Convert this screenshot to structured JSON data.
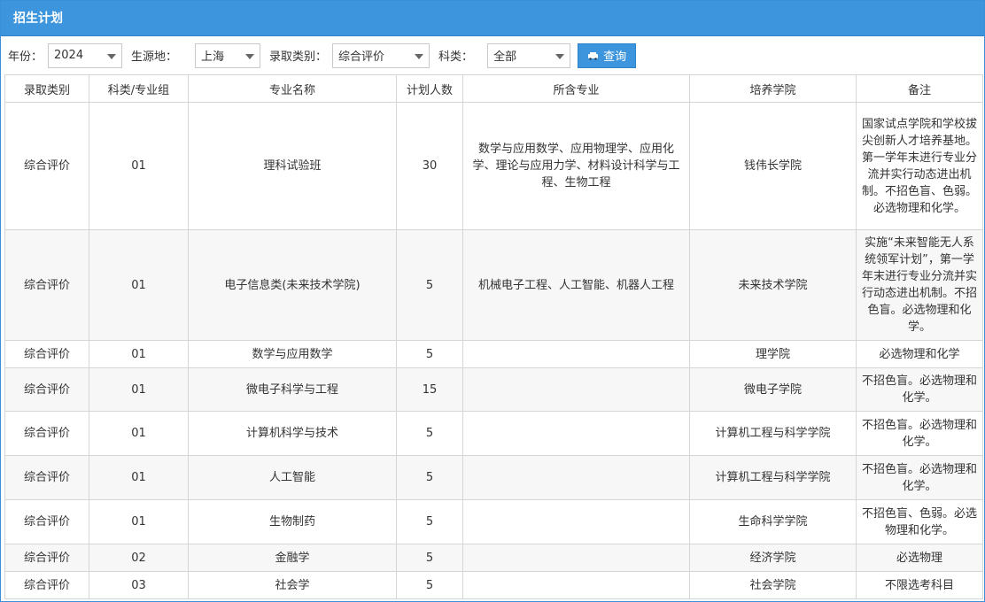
{
  "panel": {
    "title": "招生计划"
  },
  "filters": {
    "year": {
      "label": "年份：",
      "value": "2024"
    },
    "source": {
      "label": "生源地：",
      "value": "上海"
    },
    "admission_type": {
      "label": "录取类别：",
      "value": "综合评价"
    },
    "subject": {
      "label": "科类：",
      "value": "全部"
    },
    "query_button": {
      "label": "查询",
      "icon": "car-icon"
    }
  },
  "table": {
    "headers": [
      "录取类别",
      "科类/专业组",
      "专业名称",
      "计划人数",
      "所含专业",
      "培养学院",
      "备注"
    ],
    "rows": [
      [
        "综合评价",
        "01",
        "理科试验班",
        "30",
        "数学与应用数学、应用物理学、应用化学、理论与应用力学、材料设计科学与工程、生物工程",
        "钱伟长学院",
        "国家试点学院和学校拔尖创新人才培养基地。第一学年末进行专业分流并实行动态进出机制。不招色盲、色弱。必选物理和化学。"
      ],
      [
        "综合评价",
        "01",
        "电子信息类(未来技术学院)",
        "5",
        "机械电子工程、人工智能、机器人工程",
        "未来技术学院",
        "实施“未来智能无人系统领军计划”，第一学年末进行专业分流并实行动态进出机制。不招色盲。必选物理和化学。"
      ],
      [
        "综合评价",
        "01",
        "数学与应用数学",
        "5",
        "",
        "理学院",
        "必选物理和化学"
      ],
      [
        "综合评价",
        "01",
        "微电子科学与工程",
        "15",
        "",
        "微电子学院",
        "不招色盲。必选物理和化学。"
      ],
      [
        "综合评价",
        "01",
        "计算机科学与技术",
        "5",
        "",
        "计算机工程与科学学院",
        "不招色盲。必选物理和化学。"
      ],
      [
        "综合评价",
        "01",
        "人工智能",
        "5",
        "",
        "计算机工程与科学学院",
        "不招色盲。必选物理和化学。"
      ],
      [
        "综合评价",
        "01",
        "生物制药",
        "5",
        "",
        "生命科学学院",
        "不招色盲、色弱。必选物理和化学。"
      ],
      [
        "综合评价",
        "02",
        "金融学",
        "5",
        "",
        "经济学院",
        "必选物理"
      ],
      [
        "综合评价",
        "03",
        "社会学",
        "5",
        "",
        "社会学院",
        "不限选考科目"
      ]
    ]
  }
}
